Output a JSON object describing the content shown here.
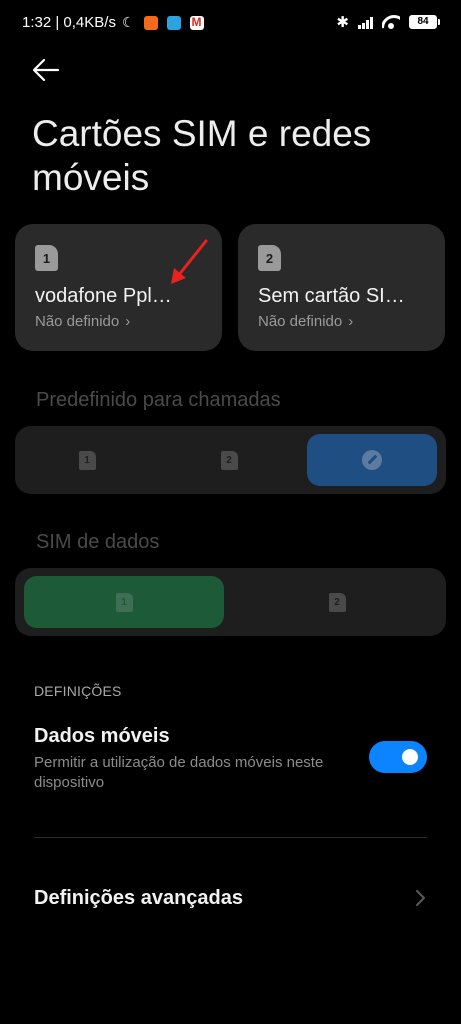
{
  "status_bar": {
    "time_speed": "1:32 | 0,4KB/s",
    "battery": "84"
  },
  "icons": {
    "back": "back-arrow-icon",
    "moon": "moon-icon",
    "bluetooth": "bluetooth-icon",
    "signal": "signal-icon",
    "wifi": "wifi-icon",
    "battery": "battery-icon",
    "edit": "edit-icon",
    "chevron": "chevron-right-icon"
  },
  "page": {
    "title": "Cartões SIM e redes móveis"
  },
  "sims": [
    {
      "slot": "1",
      "name": "vodafone Ppl…",
      "status": "Não definido"
    },
    {
      "slot": "2",
      "name": "Sem cartão SI…",
      "status": "Não definido"
    }
  ],
  "calls": {
    "header": "Predefinido para chamadas",
    "options": [
      "1",
      "2"
    ]
  },
  "data": {
    "header": "SIM de dados",
    "options": [
      "1",
      "2"
    ]
  },
  "settings": {
    "section_label": "DEFINIÇÕES",
    "mobile_data_title": "Dados móveis",
    "mobile_data_desc": "Permitir a utilização de dados móveis neste dispositivo",
    "mobile_data_on": true,
    "advanced_title": "Definições avançadas"
  },
  "colors": {
    "toggle_on": "#0d84ff",
    "calls_selected": "#1f4e82",
    "data_selected": "#1d5a38",
    "annotation_arrow": "#e8231d"
  }
}
